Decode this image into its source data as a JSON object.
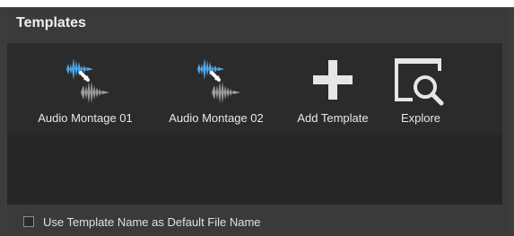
{
  "panel": {
    "title": "Templates"
  },
  "templates": [
    {
      "label": "Audio Montage 01",
      "icon": "audio-waveform-icon"
    },
    {
      "label": "Audio Montage 02",
      "icon": "audio-waveform-icon"
    },
    {
      "label": "Add Template",
      "icon": "plus-icon"
    },
    {
      "label": "Explore",
      "icon": "explore-search-icon"
    }
  ],
  "option": {
    "label": "Use Template Name as Default File Name",
    "checked": false
  },
  "colors": {
    "panel_bg": "#3a3a3a",
    "content_bg": "#262626",
    "wave_blue": "#4ea6e8",
    "wave_gray": "#9a9a9a",
    "icon_white": "#e6e6e6"
  }
}
